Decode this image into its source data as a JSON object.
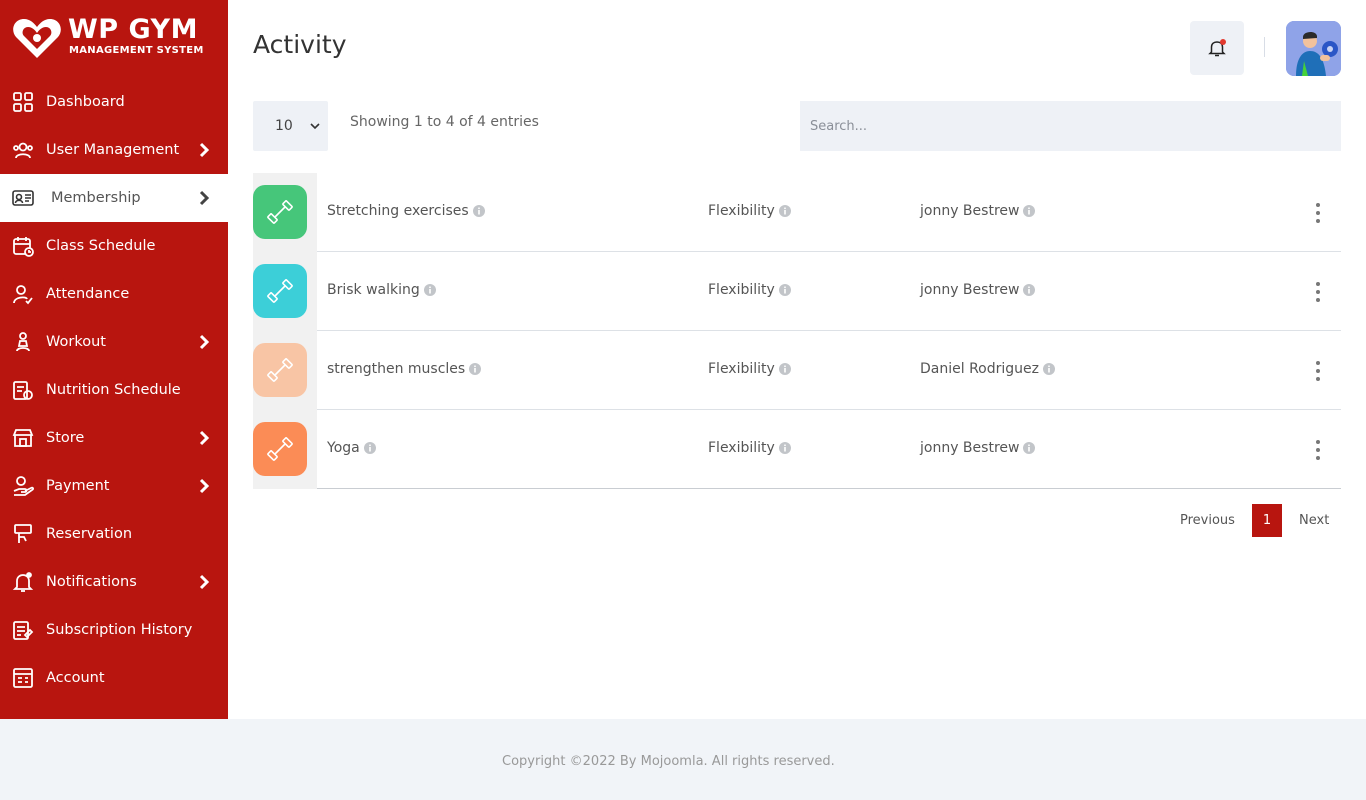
{
  "brand": {
    "title": "WP GYM",
    "subtitle": "MANAGEMENT SYSTEM"
  },
  "sidebar": {
    "items": [
      {
        "label": "Dashboard",
        "icon": "dashboard-icon",
        "has_submenu": false,
        "active": false
      },
      {
        "label": "User Management",
        "icon": "users-icon",
        "has_submenu": true,
        "active": false
      },
      {
        "label": "Membership",
        "icon": "membership-card-icon",
        "has_submenu": true,
        "active": true
      },
      {
        "label": "Class Schedule",
        "icon": "calendar-icon",
        "has_submenu": false,
        "active": false
      },
      {
        "label": "Attendance",
        "icon": "user-check-icon",
        "has_submenu": false,
        "active": false
      },
      {
        "label": "Workout",
        "icon": "workout-icon",
        "has_submenu": true,
        "active": false
      },
      {
        "label": "Nutrition Schedule",
        "icon": "nutrition-icon",
        "has_submenu": false,
        "active": false
      },
      {
        "label": "Store",
        "icon": "store-icon",
        "has_submenu": true,
        "active": false
      },
      {
        "label": "Payment",
        "icon": "payment-icon",
        "has_submenu": true,
        "active": false
      },
      {
        "label": "Reservation",
        "icon": "reservation-icon",
        "has_submenu": false,
        "active": false
      },
      {
        "label": "Notifications",
        "icon": "bell-icon",
        "has_submenu": true,
        "active": false
      },
      {
        "label": "Subscription History",
        "icon": "subscription-icon",
        "has_submenu": false,
        "active": false
      },
      {
        "label": "Account",
        "icon": "account-icon",
        "has_submenu": false,
        "active": false
      }
    ]
  },
  "header": {
    "title": "Activity"
  },
  "table_controls": {
    "page_length": "10",
    "info": "Showing 1 to 4 of 4 entries",
    "search_placeholder": "Search..."
  },
  "rows": [
    {
      "name": "Stretching exercises",
      "category": "Flexibility",
      "assigned_to": "jonny Bestrew",
      "color": "#46c67a"
    },
    {
      "name": "Brisk walking",
      "category": "Flexibility",
      "assigned_to": "jonny Bestrew",
      "color": "#3ccfd8"
    },
    {
      "name": "strengthen muscles",
      "category": "Flexibility",
      "assigned_to": "Daniel Rodriguez",
      "color": "#f8c5a5"
    },
    {
      "name": "Yoga",
      "category": "Flexibility",
      "assigned_to": "jonny Bestrew",
      "color": "#fb8c56"
    }
  ],
  "pagination": {
    "previous": "Previous",
    "current": "1",
    "next": "Next"
  },
  "footer": {
    "text": "Copyright ©2022 By Mojoomla. All rights reserved."
  },
  "colors": {
    "brand_red": "#b8150f",
    "panel_bg": "#eef1f6"
  }
}
